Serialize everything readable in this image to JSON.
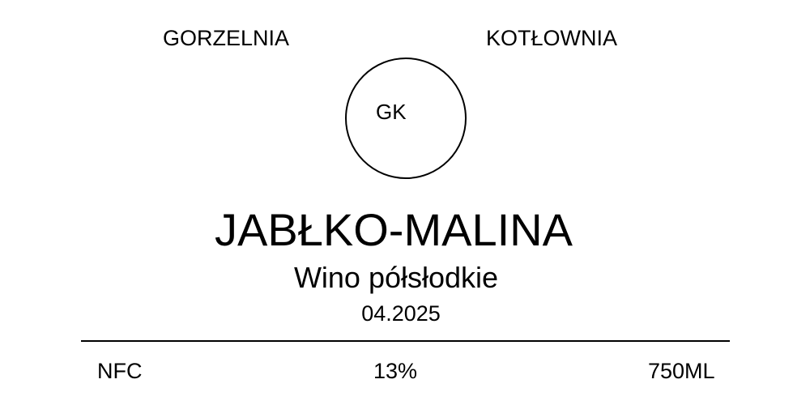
{
  "header": {
    "left_text": "GORZELNIA",
    "right_text": "KOTŁOWNIA"
  },
  "monogram": {
    "text": "GK"
  },
  "product": {
    "name": "JABŁKO-MALINA",
    "type": "Wino półsłodkie",
    "date": "04.2025"
  },
  "footer": {
    "left": "NFC",
    "center": "13%",
    "right": "750ML"
  }
}
